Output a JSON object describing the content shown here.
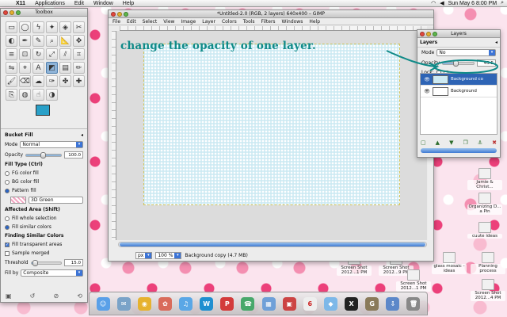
{
  "menubar": {
    "apple": "",
    "app": "X11",
    "items": [
      "Applications",
      "Edit",
      "Window",
      "Help"
    ],
    "clock": "Sun May 6  8:00 PM"
  },
  "annotation": {
    "text": "change the opacity of one layer.",
    "color": "#0f8a88"
  },
  "toolbox": {
    "title": "Toolbox",
    "tool_icons": [
      "rect-select-icon",
      "ellipse-select-icon",
      "free-select-icon",
      "fuzzy-select-icon",
      "color-select-icon",
      "scissors-select-icon",
      "foreground-select-icon",
      "paths-icon",
      "color-picker-icon",
      "zoom-icon",
      "measure-icon",
      "move-icon",
      "align-icon",
      "crop-icon",
      "rotate-icon",
      "scale-icon",
      "shear-icon",
      "perspective-icon",
      "flip-icon",
      "cage-icon",
      "text-icon",
      "bucket-fill-icon",
      "blend-icon",
      "pencil-icon",
      "paintbrush-icon",
      "eraser-icon",
      "airbrush-icon",
      "ink-icon",
      "clone-icon",
      "heal-icon",
      "perspective-clone-icon",
      "blur-icon",
      "smudge-icon",
      "dodge-burn-icon"
    ],
    "fg_color": "#29a0c8",
    "bg_color": "#ffffff",
    "options": {
      "tool_name": "Bucket Fill",
      "mode_label": "Mode",
      "mode_value": "Normal",
      "opacity_label": "Opacity",
      "opacity_value": "100.0",
      "fill_type_label": "Fill Type  (Ctrl)",
      "fill_types": [
        "FG color fill",
        "BG color fill",
        "Pattern fill"
      ],
      "pattern_name": "3D Green",
      "affected_label": "Affected Area  (Shift)",
      "affected": [
        "Fill whole selection",
        "Fill similar colors"
      ],
      "finding_label": "Finding Similar Colors",
      "fill_transparent": "Fill transparent areas",
      "sample_merged": "Sample merged",
      "threshold_label": "Threshold",
      "threshold_value": "15.0",
      "fill_by_label": "Fill by",
      "fill_by_value": "Composite"
    }
  },
  "image_window": {
    "title": "*Untitled-2.0 (RGB, 2 layers) 640x400 – GIMP",
    "menus": [
      "File",
      "Edit",
      "Select",
      "View",
      "Image",
      "Layer",
      "Colors",
      "Tools",
      "Filters",
      "Windows",
      "Help"
    ],
    "unit": "px",
    "zoom": "100 %",
    "status": "Background copy (4.7 MB)"
  },
  "layers_dialog": {
    "title": "Layers",
    "tab": "Layers",
    "mode_label": "Mode",
    "mode_value": "No",
    "opacity_label": "Opacity",
    "opacity_value": "43.5",
    "opacity_fraction": 0.435,
    "lock_label": "Lock:",
    "layers": [
      {
        "name": "Background co",
        "selected": true,
        "thumb": "#cdeaf3"
      },
      {
        "name": "Background",
        "selected": false,
        "thumb": "#ffffff"
      }
    ]
  },
  "desktop_icons": [
    {
      "label": "Jamie & Christ..."
    },
    {
      "label": "Organizing D... a Pin"
    },
    {
      "label": "cuute ideas"
    },
    {
      "label": "Screen Shot 2012...1 PM"
    },
    {
      "label": "Screen Shot 2012...9 PM"
    },
    {
      "label": "Screen Shot 2012...1 PM"
    },
    {
      "label": "glass mosaic - ideas"
    },
    {
      "label": "Planning process"
    },
    {
      "label": "Screen Shot 2012...4 PM"
    }
  ],
  "dock": {
    "items": [
      "finder-icon",
      "mail-icon",
      "chrome-icon",
      "photos-icon",
      "itunes-icon",
      "wunderlist-icon",
      "pinterest-icon",
      "facetime-icon",
      "folder-icon",
      "photo-booth-icon",
      "calendar-icon",
      "preview-icon",
      "x11-icon",
      "gimp-icon",
      "downloads-icon",
      "trash-icon"
    ]
  }
}
